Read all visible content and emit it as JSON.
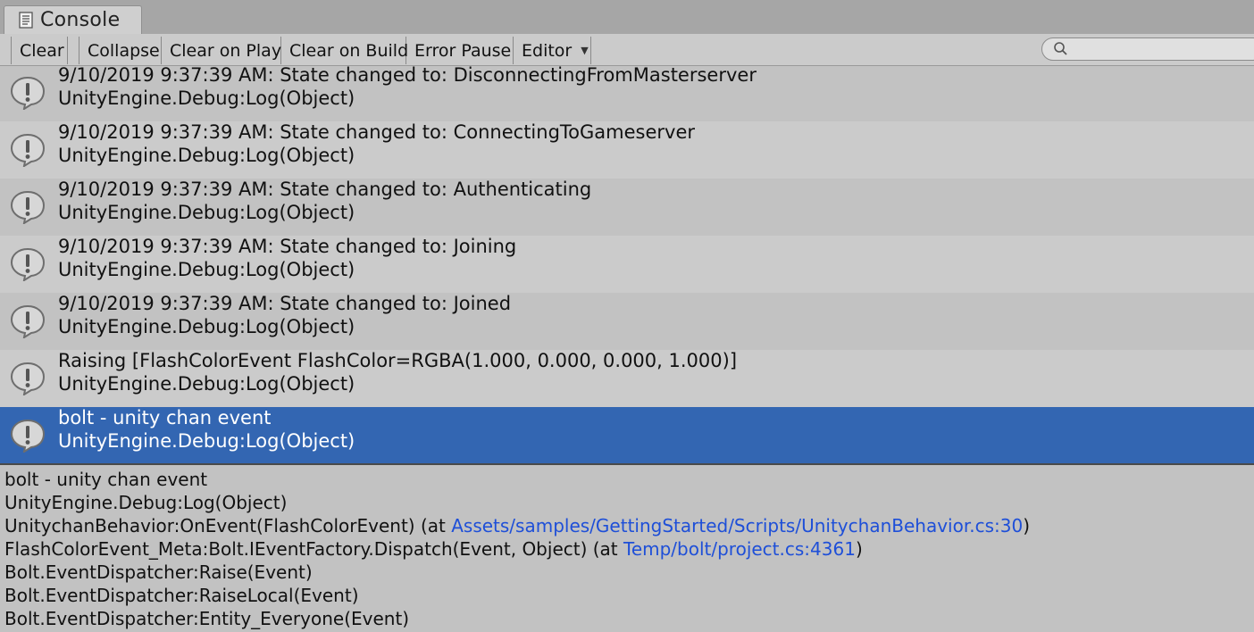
{
  "window": {
    "tab_label": "Console",
    "tab_icon": "console-icon"
  },
  "toolbar": {
    "clear": "Clear",
    "collapse": "Collapse",
    "clear_on_play": "Clear on Play",
    "clear_on_build": "Clear on Build",
    "error_pause": "Error Pause",
    "editor": "Editor",
    "search_placeholder": ""
  },
  "log": {
    "icon": "info-speech-bubble-icon",
    "entries": [
      {
        "message": "9/10/2019 9:37:39 AM: State changed to: DisconnectingFromMasterserver",
        "trace": "UnityEngine.Debug:Log(Object)"
      },
      {
        "message": "9/10/2019 9:37:39 AM: State changed to: ConnectingToGameserver",
        "trace": "UnityEngine.Debug:Log(Object)"
      },
      {
        "message": "9/10/2019 9:37:39 AM: State changed to: Authenticating",
        "trace": "UnityEngine.Debug:Log(Object)"
      },
      {
        "message": "9/10/2019 9:37:39 AM: State changed to: Joining",
        "trace": "UnityEngine.Debug:Log(Object)"
      },
      {
        "message": "9/10/2019 9:37:39 AM: State changed to: Joined",
        "trace": "UnityEngine.Debug:Log(Object)"
      },
      {
        "message": "Raising [FlashColorEvent FlashColor=RGBA(1.000, 0.000, 0.000, 1.000)]",
        "trace": "UnityEngine.Debug:Log(Object)"
      },
      {
        "message": "bolt - unity chan event",
        "trace": "UnityEngine.Debug:Log(Object)",
        "selected": true
      }
    ]
  },
  "details": {
    "line1": "bolt - unity chan event",
    "line2": "UnityEngine.Debug:Log(Object)",
    "line3_prefix": "UnitychanBehavior:OnEvent(FlashColorEvent) (at ",
    "line3_link": "Assets/samples/GettingStarted/Scripts/UnitychanBehavior.cs:30",
    "line3_suffix": ")",
    "line4_prefix": "FlashColorEvent_Meta:Bolt.IEventFactory.Dispatch(Event, Object) (at ",
    "line4_link": "Temp/bolt/project.cs:4361",
    "line4_suffix": ")",
    "line5": "Bolt.EventDispatcher:Raise(Event)",
    "line6": "Bolt.EventDispatcher:RaiseLocal(Event)",
    "line7": "Bolt.EventDispatcher:Entity_Everyone(Event)"
  },
  "colors": {
    "selection": "#3366b2",
    "link": "#1e4fd8",
    "background": "#c2c2c2"
  }
}
